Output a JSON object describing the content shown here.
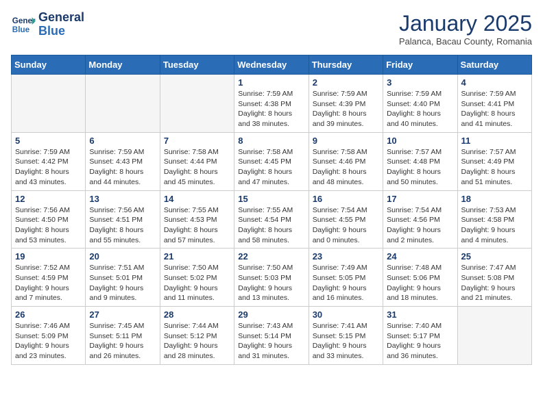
{
  "header": {
    "logo_line1": "General",
    "logo_line2": "Blue",
    "month_title": "January 2025",
    "subtitle": "Palanca, Bacau County, Romania"
  },
  "weekdays": [
    "Sunday",
    "Monday",
    "Tuesday",
    "Wednesday",
    "Thursday",
    "Friday",
    "Saturday"
  ],
  "weeks": [
    [
      {
        "day": "",
        "empty": true
      },
      {
        "day": "",
        "empty": true
      },
      {
        "day": "",
        "empty": true
      },
      {
        "day": "1",
        "sunrise": "7:59 AM",
        "sunset": "4:38 PM",
        "daylight": "8 hours and 38 minutes."
      },
      {
        "day": "2",
        "sunrise": "7:59 AM",
        "sunset": "4:39 PM",
        "daylight": "8 hours and 39 minutes."
      },
      {
        "day": "3",
        "sunrise": "7:59 AM",
        "sunset": "4:40 PM",
        "daylight": "8 hours and 40 minutes."
      },
      {
        "day": "4",
        "sunrise": "7:59 AM",
        "sunset": "4:41 PM",
        "daylight": "8 hours and 41 minutes."
      }
    ],
    [
      {
        "day": "5",
        "sunrise": "7:59 AM",
        "sunset": "4:42 PM",
        "daylight": "8 hours and 43 minutes."
      },
      {
        "day": "6",
        "sunrise": "7:59 AM",
        "sunset": "4:43 PM",
        "daylight": "8 hours and 44 minutes."
      },
      {
        "day": "7",
        "sunrise": "7:58 AM",
        "sunset": "4:44 PM",
        "daylight": "8 hours and 45 minutes."
      },
      {
        "day": "8",
        "sunrise": "7:58 AM",
        "sunset": "4:45 PM",
        "daylight": "8 hours and 47 minutes."
      },
      {
        "day": "9",
        "sunrise": "7:58 AM",
        "sunset": "4:46 PM",
        "daylight": "8 hours and 48 minutes."
      },
      {
        "day": "10",
        "sunrise": "7:57 AM",
        "sunset": "4:48 PM",
        "daylight": "8 hours and 50 minutes."
      },
      {
        "day": "11",
        "sunrise": "7:57 AM",
        "sunset": "4:49 PM",
        "daylight": "8 hours and 51 minutes."
      }
    ],
    [
      {
        "day": "12",
        "sunrise": "7:56 AM",
        "sunset": "4:50 PM",
        "daylight": "8 hours and 53 minutes."
      },
      {
        "day": "13",
        "sunrise": "7:56 AM",
        "sunset": "4:51 PM",
        "daylight": "8 hours and 55 minutes."
      },
      {
        "day": "14",
        "sunrise": "7:55 AM",
        "sunset": "4:53 PM",
        "daylight": "8 hours and 57 minutes."
      },
      {
        "day": "15",
        "sunrise": "7:55 AM",
        "sunset": "4:54 PM",
        "daylight": "8 hours and 58 minutes."
      },
      {
        "day": "16",
        "sunrise": "7:54 AM",
        "sunset": "4:55 PM",
        "daylight": "9 hours and 0 minutes."
      },
      {
        "day": "17",
        "sunrise": "7:54 AM",
        "sunset": "4:56 PM",
        "daylight": "9 hours and 2 minutes."
      },
      {
        "day": "18",
        "sunrise": "7:53 AM",
        "sunset": "4:58 PM",
        "daylight": "9 hours and 4 minutes."
      }
    ],
    [
      {
        "day": "19",
        "sunrise": "7:52 AM",
        "sunset": "4:59 PM",
        "daylight": "9 hours and 7 minutes."
      },
      {
        "day": "20",
        "sunrise": "7:51 AM",
        "sunset": "5:01 PM",
        "daylight": "9 hours and 9 minutes."
      },
      {
        "day": "21",
        "sunrise": "7:50 AM",
        "sunset": "5:02 PM",
        "daylight": "9 hours and 11 minutes."
      },
      {
        "day": "22",
        "sunrise": "7:50 AM",
        "sunset": "5:03 PM",
        "daylight": "9 hours and 13 minutes."
      },
      {
        "day": "23",
        "sunrise": "7:49 AM",
        "sunset": "5:05 PM",
        "daylight": "9 hours and 16 minutes."
      },
      {
        "day": "24",
        "sunrise": "7:48 AM",
        "sunset": "5:06 PM",
        "daylight": "9 hours and 18 minutes."
      },
      {
        "day": "25",
        "sunrise": "7:47 AM",
        "sunset": "5:08 PM",
        "daylight": "9 hours and 21 minutes."
      }
    ],
    [
      {
        "day": "26",
        "sunrise": "7:46 AM",
        "sunset": "5:09 PM",
        "daylight": "9 hours and 23 minutes."
      },
      {
        "day": "27",
        "sunrise": "7:45 AM",
        "sunset": "5:11 PM",
        "daylight": "9 hours and 26 minutes."
      },
      {
        "day": "28",
        "sunrise": "7:44 AM",
        "sunset": "5:12 PM",
        "daylight": "9 hours and 28 minutes."
      },
      {
        "day": "29",
        "sunrise": "7:43 AM",
        "sunset": "5:14 PM",
        "daylight": "9 hours and 31 minutes."
      },
      {
        "day": "30",
        "sunrise": "7:41 AM",
        "sunset": "5:15 PM",
        "daylight": "9 hours and 33 minutes."
      },
      {
        "day": "31",
        "sunrise": "7:40 AM",
        "sunset": "5:17 PM",
        "daylight": "9 hours and 36 minutes."
      },
      {
        "day": "",
        "empty": true
      }
    ]
  ]
}
